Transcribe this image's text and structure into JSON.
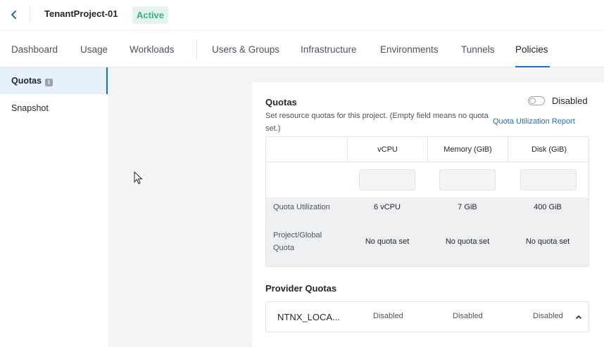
{
  "header": {
    "project_title": "TenantProject-01",
    "status": "Active"
  },
  "tabs": [
    {
      "label": "Dashboard"
    },
    {
      "label": "Usage"
    },
    {
      "label": "Workloads"
    },
    {
      "label": "Users & Groups"
    },
    {
      "label": "Infrastructure"
    },
    {
      "label": "Environments"
    },
    {
      "label": "Tunnels"
    },
    {
      "label": "Policies",
      "active": true
    }
  ],
  "sidebar": {
    "items": [
      {
        "label": "Quotas",
        "active": true
      },
      {
        "label": "Snapshot"
      }
    ]
  },
  "quotas": {
    "title": "Quotas",
    "description": "Set resource quotas for this project. (Empty field means no quota set.)",
    "toggle_label": "Disabled",
    "report_link": "Quota Utilization Report",
    "columns": [
      "vCPU",
      "Memory (GiB)",
      "Disk (GiB)"
    ],
    "inputs": [
      "",
      "",
      ""
    ],
    "utilization_label": "Quota Utilization",
    "utilization": [
      "6 vCPU",
      "7 GiB",
      "400 GiB"
    ],
    "global_label": "Project/Global Quota",
    "global": [
      "No quota set",
      "No quota set",
      "No quota set"
    ]
  },
  "provider_quotas": {
    "title": "Provider Quotas",
    "rows": [
      {
        "name": "NTNX_LOCA...",
        "values": [
          "Disabled",
          "Disabled",
          "Disabled"
        ]
      }
    ]
  },
  "colors": {
    "accent": "#1b6dc6",
    "active_badge_text": "#36b37e",
    "active_badge_bg": "#e3f5ea"
  }
}
